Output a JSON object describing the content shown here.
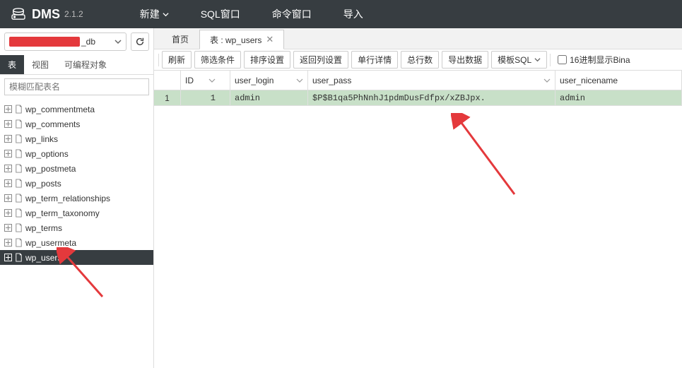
{
  "header": {
    "app_name": "DMS",
    "app_version": "2.1.2",
    "menu": {
      "new": "新建",
      "sql_window": "SQL窗口",
      "cmd_window": "命令窗口",
      "import": "导入"
    }
  },
  "sidebar": {
    "db_suffix": "_db",
    "tabs": {
      "table": "表",
      "view": "视图",
      "programmable": "可编程对象"
    },
    "filter_placeholder": "模糊匹配表名",
    "tables": [
      "wp_commentmeta",
      "wp_comments",
      "wp_links",
      "wp_options",
      "wp_postmeta",
      "wp_posts",
      "wp_term_relationships",
      "wp_term_taxonomy",
      "wp_terms",
      "wp_usermeta",
      "wp_users"
    ],
    "selected_table": "wp_users"
  },
  "content": {
    "tabs": {
      "home": "首页",
      "current": "表 : wp_users"
    },
    "toolbar": {
      "refresh": "刷新",
      "filter": "筛选条件",
      "sort": "排序设置",
      "return_cols": "返回列设置",
      "row_detail": "单行详情",
      "total_rows": "总行数",
      "export": "导出数据",
      "template_sql": "模板SQL",
      "hex_display": "16进制显示Bina"
    },
    "grid": {
      "columns": {
        "id": "ID",
        "user_login": "user_login",
        "user_pass": "user_pass",
        "user_nicename": "user_nicename"
      },
      "rows": [
        {
          "rownum": "1",
          "id": "1",
          "user_login": "admin",
          "user_pass": "$P$B1qa5PhNnhJ1pdmDusFdfpx/xZBJpx.",
          "user_nicename": "admin"
        }
      ]
    }
  }
}
